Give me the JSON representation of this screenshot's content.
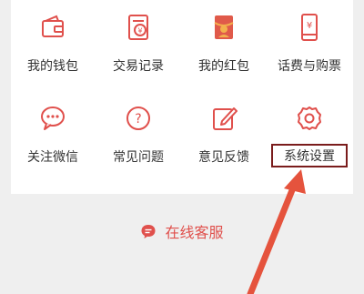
{
  "menu": {
    "row1": [
      {
        "label": "我的钱包",
        "icon": "wallet-icon"
      },
      {
        "label": "交易记录",
        "icon": "transaction-record-icon"
      },
      {
        "label": "我的红包",
        "icon": "red-envelope-icon"
      },
      {
        "label": "话费与购票",
        "icon": "phone-bill-ticket-icon"
      }
    ],
    "row2": [
      {
        "label": "关注微信",
        "icon": "wechat-chat-icon"
      },
      {
        "label": "常见问题",
        "icon": "question-icon"
      },
      {
        "label": "意见反馈",
        "icon": "feedback-edit-icon"
      },
      {
        "label": "系统设置",
        "icon": "settings-gear-icon"
      }
    ]
  },
  "service": {
    "label": "在线客服",
    "icon": "chat-bubble-icon"
  },
  "colors": {
    "accent": "#e0504c",
    "highlight_box": "#7a1c1c",
    "arrow": "#e5533d"
  }
}
